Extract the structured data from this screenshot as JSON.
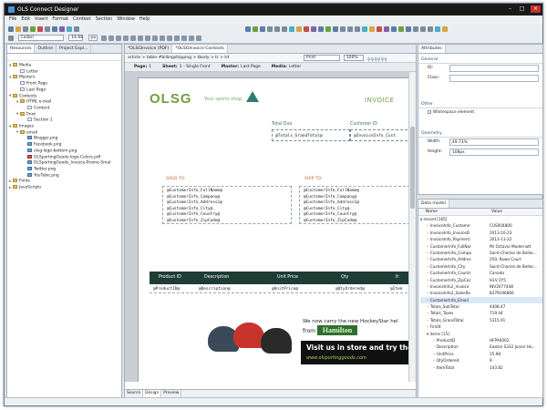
{
  "window": {
    "title": "OLS Connect Designer"
  },
  "menu": [
    "File",
    "Edit",
    "Insert",
    "Format",
    "Context",
    "Section",
    "Window",
    "Help"
  ],
  "toolbar": {
    "font": "Calibri",
    "size": "14.66",
    "unit": "px"
  },
  "left_panel": {
    "tabs": [
      "Resources",
      "Outline",
      "Project Expl..."
    ],
    "tree": [
      {
        "label": "Media",
        "level": 0,
        "type": "folder",
        "open": true
      },
      {
        "label": "Letter",
        "level": 1,
        "type": "file"
      },
      {
        "label": "Masters",
        "level": 0,
        "type": "folder",
        "open": true
      },
      {
        "label": "Front Page",
        "level": 1,
        "type": "file"
      },
      {
        "label": "Last Page",
        "level": 1,
        "type": "file"
      },
      {
        "label": "Contexts",
        "level": 0,
        "type": "folder",
        "open": true
      },
      {
        "label": "HTML e-mail",
        "level": 1,
        "type": "folder",
        "open": true
      },
      {
        "label": "Content",
        "level": 2,
        "type": "file"
      },
      {
        "label": "Print",
        "level": 1,
        "type": "folder",
        "open": true
      },
      {
        "label": "Section 1",
        "level": 2,
        "type": "file"
      },
      {
        "label": "Images",
        "level": 0,
        "type": "folder",
        "open": true
      },
      {
        "label": "email",
        "level": 1,
        "type": "folder",
        "open": true
      },
      {
        "label": "Blogger.png",
        "level": 2,
        "type": "img"
      },
      {
        "label": "Facebook.png",
        "level": 2,
        "type": "img"
      },
      {
        "label": "olsg-logo-bottom.png",
        "level": 2,
        "type": "img"
      },
      {
        "label": "OLSportingGoods-logo-Colors.pdf",
        "level": 2,
        "type": "pdf"
      },
      {
        "label": "OLSportingGoods_Invoice-Promo-Smal",
        "level": 2,
        "type": "img"
      },
      {
        "label": "Twitter.png",
        "level": 2,
        "type": "img"
      },
      {
        "label": "YouTube.png",
        "level": 2,
        "type": "img"
      },
      {
        "label": "Fonts",
        "level": 0,
        "type": "folder",
        "open": false
      },
      {
        "label": "JavaScripts",
        "level": 0,
        "type": "folder",
        "open": false
      }
    ]
  },
  "editor": {
    "tabs": [
      "*OLSGInvoice (PDF)",
      "*OLSGInvoice-Contexts"
    ],
    "breadcrumb": "article > table #billingshipping > tbody > tr > td",
    "mode": "Print",
    "zoom": "100%",
    "sections_bar": [
      {
        "k": "Page:",
        "v": "1"
      },
      {
        "k": "Sheet:",
        "v": "1 - Single Front"
      },
      {
        "k": "Master:",
        "v": "Last Page"
      },
      {
        "k": "Media:",
        "v": "Letter"
      }
    ],
    "bottom_tabs": [
      "Source",
      "Design",
      "Preview"
    ],
    "document": {
      "logo": "OLSG",
      "slogan": "Your sports shop.",
      "invoice_title": "INVOICE",
      "total_due_label": "Total Due",
      "customer_id_label": "Customer ID",
      "total_field": "@Totals_GrandTotal@",
      "customer_id_field": "@InvoiceInfo_Cust",
      "sold_to": "SOLD TO:",
      "ship_to": "SHIP TO:",
      "sold_lines": [
        "@CustomerInfo_FullName@",
        "@CustomerInfo_Company@",
        "@CustomerInfo_Address1@",
        "@CustomerInfo_City@",
        "@CustomerInfo_Country@",
        "@CustomerInfo_ZipCode@"
      ],
      "ship_lines": [
        "@CustomerInfo_FullName@",
        "@CustomerInfo_Company@",
        "@CustomerInfo_Address1@",
        "@CustomerInfo_City@",
        "@CustomerInfo_Country@",
        "@CustomerInfo_ZipCode@"
      ],
      "table_headers": [
        "Product ID",
        "Description",
        "Unit Price",
        "Qty",
        "It"
      ],
      "table_row": [
        "@ProductID@",
        "@Description@",
        "@UnitPrice@",
        "@QtyOrdered@",
        "@Item"
      ],
      "banner_text": "We now carry the new HockeyStar hel",
      "banner_from": "from",
      "banner_brand": "Hamilton",
      "banner_visit": "Visit us in store and try them o",
      "banner_url": "www.olsportinggoods.com"
    }
  },
  "attributes": {
    "tab": "Attributes",
    "general": "General",
    "id_label": "ID:",
    "class_label": "Class:",
    "other": "Other",
    "whitespace": "Whitespace element",
    "geometry": "Geometry",
    "width_label": "Width:",
    "width_value": "49.73%",
    "height_label": "Height:",
    "height_value": "108px"
  },
  "data_model": {
    "tab": "Data model",
    "col_name": "Name",
    "col_value": "Value",
    "pager": "1",
    "rows": [
      {
        "k": "record [165]",
        "v": "",
        "indent": 0,
        "open": true
      },
      {
        "k": "InvoiceInfo_Custome",
        "v": "CUS004800",
        "indent": 1
      },
      {
        "k": "InvoiceInfo_InvoiceD",
        "v": "2013-10-23",
        "indent": 1
      },
      {
        "k": "InvoiceInfo_Payment",
        "v": "2013-11-22",
        "indent": 1
      },
      {
        "k": "CustomerInfo_FullNar",
        "v": "Mr Octavio Modernott",
        "indent": 1
      },
      {
        "k": "CustomerInfo_Compa",
        "v": "Saint-Charles de Bellec...",
        "indent": 1
      },
      {
        "k": "CustomerInfo_Addres",
        "v": "250, Rowe Court",
        "indent": 1
      },
      {
        "k": "CustomerInfo_City",
        "v": "Saint-Charles de Bellec...",
        "indent": 1
      },
      {
        "k": "CustomerInfo_Countr",
        "v": "Canada",
        "indent": 1
      },
      {
        "k": "CustomerInfo_ZipCoc",
        "v": "H1V 2Y5",
        "indent": 1
      },
      {
        "k": "InvoiceInfo2_Invoice",
        "v": "INV2077448",
        "indent": 1
      },
      {
        "k": "InvoiceInfo2_SalesRe",
        "v": "8379196866",
        "indent": 1
      },
      {
        "k": "CustomerInfo_Email",
        "v": "",
        "indent": 1,
        "sel": true
      },
      {
        "k": "Totals_SubTotal",
        "v": "4408.47",
        "indent": 1
      },
      {
        "k": "Totals_Taxes",
        "v": "719.44",
        "indent": 1
      },
      {
        "k": "Totals_GrandTotal",
        "v": "5315.91",
        "indent": 1
      },
      {
        "k": "FirstIt",
        "v": "",
        "indent": 1
      },
      {
        "k": "items [15]",
        "v": "",
        "indent": 1,
        "open": true
      },
      {
        "k": "ProductID",
        "v": "HFPA0002",
        "indent": 2
      },
      {
        "k": "Description",
        "v": "Easton S332 Junior Ho...",
        "indent": 2
      },
      {
        "k": "UnitPrice",
        "v": "15.98",
        "indent": 2
      },
      {
        "k": "QtyOrdered",
        "v": "9",
        "indent": 2
      },
      {
        "k": "ItemTotal",
        "v": "143.82",
        "indent": 2
      }
    ]
  }
}
